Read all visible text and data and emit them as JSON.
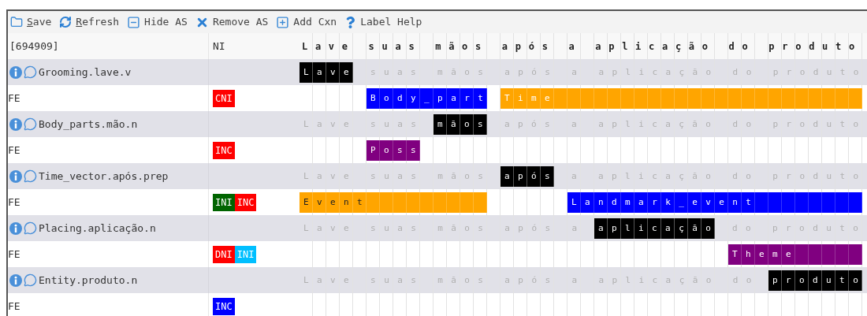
{
  "toolbar": [
    {
      "kind": "save",
      "label": "Save",
      "underline_first": true
    },
    {
      "kind": "refresh",
      "label": "Refresh",
      "underline_first": true
    },
    {
      "kind": "hide",
      "label": "Hide AS",
      "underline_first": false
    },
    {
      "kind": "remove",
      "label": "Remove AS",
      "underline_first": false
    },
    {
      "kind": "add",
      "label": "Add Cxn",
      "underline_first": false
    },
    {
      "kind": "help",
      "label": "Label Help",
      "underline_first": false
    }
  ],
  "header": {
    "id": "[694909]",
    "ni": "NI",
    "sentence": "Lave suas mãos após a aplicação do produto"
  },
  "annotations": [
    {
      "frame": "Grooming.lave.v",
      "segments": [
        {
          "kind": "target",
          "text": "Lave"
        },
        {
          "kind": "context",
          "text": "suas mãos após a aplicação do produto"
        }
      ],
      "fe_row": {
        "label": "FE",
        "ni": [
          {
            "label": "CNI",
            "color": "#ff0000"
          }
        ],
        "spans": [
          {
            "label": "Body_part",
            "color": "#0000ff",
            "dark_text": false
          },
          {
            "label": "Time",
            "color": "#ffa500",
            "dark_text": false
          }
        ]
      }
    },
    {
      "frame": "Body_parts.mão.n",
      "segments": [
        {
          "kind": "context",
          "text": "Lave suas"
        },
        {
          "kind": "target",
          "text": "mãos"
        },
        {
          "kind": "context",
          "text": "após a aplicação do produto"
        }
      ],
      "fe_row": {
        "label": "FE",
        "ni": [
          {
            "label": "INC",
            "color": "#ff0000"
          }
        ],
        "spans": [
          {
            "label": "Poss",
            "color": "#800080",
            "dark_text": false
          }
        ]
      }
    },
    {
      "frame": "Time_vector.após.prep",
      "segments": [
        {
          "kind": "context",
          "text": "Lave suas mãos"
        },
        {
          "kind": "target",
          "text": "após"
        },
        {
          "kind": "context",
          "text": "a aplicação do produto"
        }
      ],
      "fe_row": {
        "label": "FE",
        "ni": [
          {
            "label": "INI",
            "color": "#006400"
          },
          {
            "label": "INC",
            "color": "#ff0000"
          }
        ],
        "spans": [
          {
            "label": "Event",
            "color": "#ffa500",
            "dark_text": true
          },
          {
            "label": "Landmark_event",
            "color": "#0000ff",
            "dark_text": false
          }
        ]
      }
    },
    {
      "frame": "Placing.aplicação.n",
      "segments": [
        {
          "kind": "context",
          "text": "Lave suas mãos após a"
        },
        {
          "kind": "target",
          "text": "aplicação"
        },
        {
          "kind": "context",
          "text": "do produto"
        }
      ],
      "fe_row": {
        "label": "FE",
        "ni": [
          {
            "label": "DNI",
            "color": "#ff0000"
          },
          {
            "label": "INI",
            "color": "#00bfff"
          }
        ],
        "spans": [
          {
            "label": "Theme",
            "color": "#800080",
            "dark_text": false
          }
        ]
      }
    },
    {
      "frame": "Entity.produto.n",
      "segments": [
        {
          "kind": "context",
          "text": "Lave suas mãos após a aplicação do"
        },
        {
          "kind": "target",
          "text": "produto"
        }
      ],
      "fe_row": {
        "label": "FE",
        "ni": [
          {
            "label": "INC",
            "color": "#0000ff"
          }
        ]
      }
    }
  ]
}
